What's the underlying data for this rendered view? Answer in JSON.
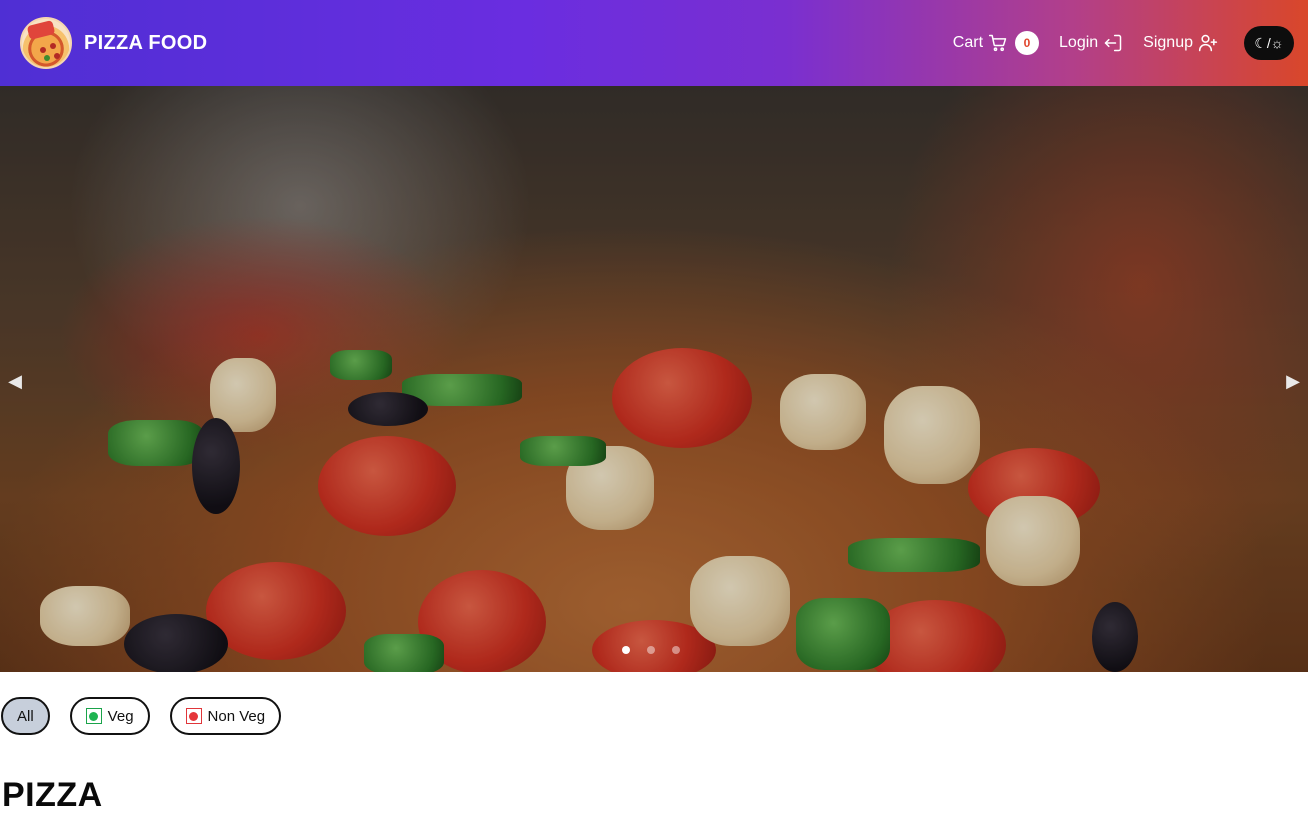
{
  "nav": {
    "brand": "PIZZA FOOD",
    "cart_label": "Cart",
    "cart_count": "0",
    "login_label": "Login",
    "signup_label": "Signup",
    "theme_toggle_label": "☾/☼"
  },
  "carousel": {
    "prev_label": "◀",
    "next_label": "▶",
    "slides_count": 3,
    "active_slide": 1
  },
  "filters": {
    "all_label": "All",
    "veg_label": "Veg",
    "nonveg_label": "Non Veg",
    "active": "All"
  },
  "section": {
    "title": "PIZZA"
  },
  "icons": [
    "logo",
    "cart-icon",
    "login-icon",
    "signup-icon",
    "theme-toggle",
    "veg-icon",
    "nonveg-icon"
  ],
  "colors": {
    "nav_gradient_start": "#4f2fd4",
    "nav_gradient_end": "#d9472a",
    "badge_text": "#e0452c",
    "veg": "#1fb451",
    "nonveg": "#e5363a",
    "active_chip": "#c7cfdb"
  }
}
